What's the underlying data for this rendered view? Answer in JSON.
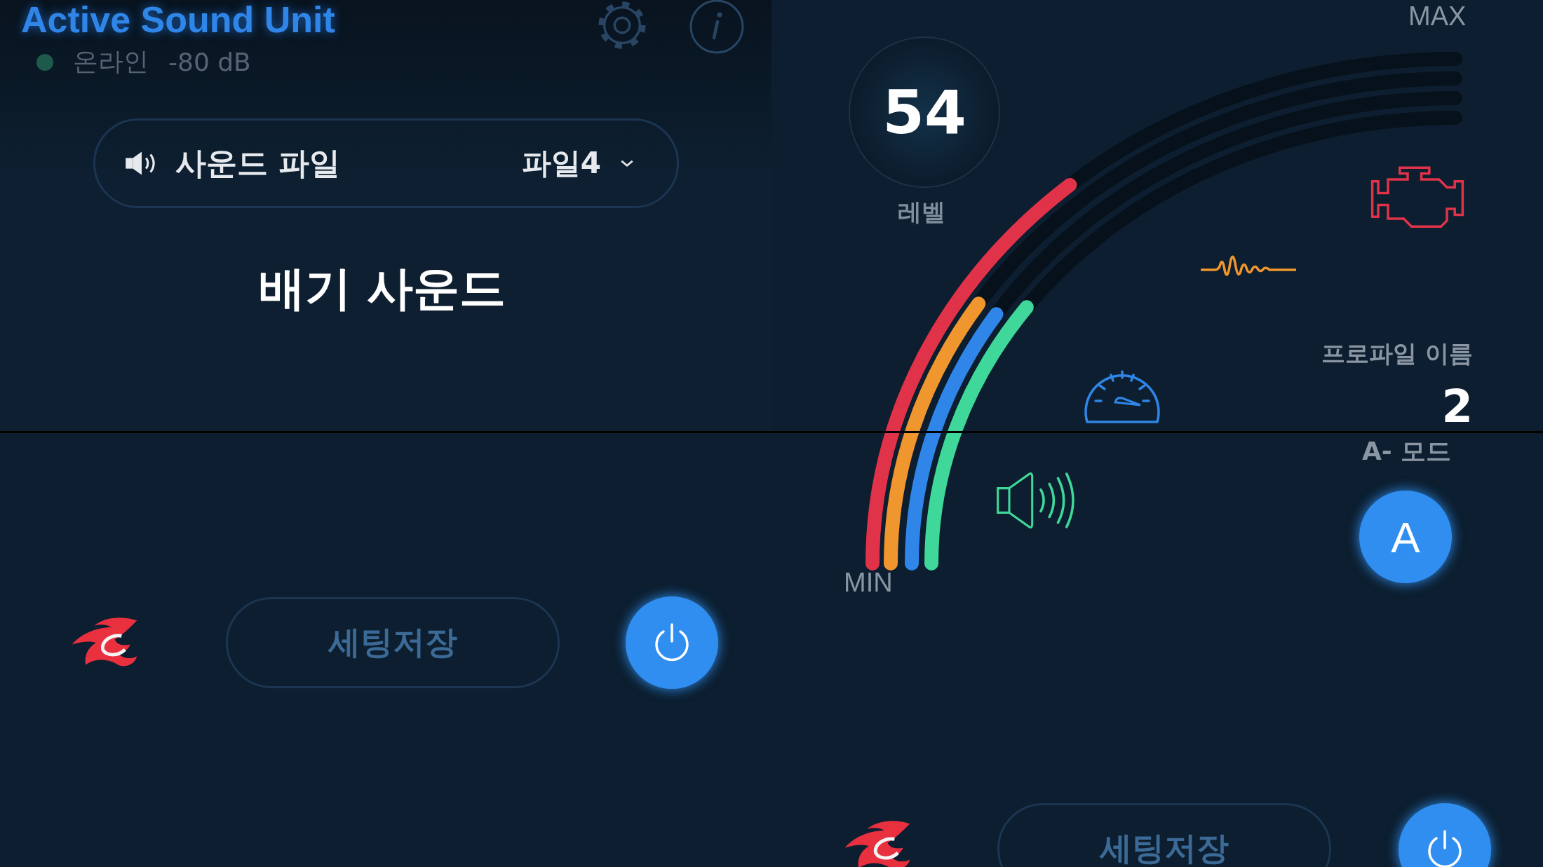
{
  "header": {
    "title": "Active Sound Unit",
    "status": "온라인",
    "reading": "-80 dB"
  },
  "sound_file": {
    "label": "사운드 파일",
    "value": "파일4"
  },
  "mode_title": "배기 사운드",
  "footer": {
    "save_button": "세팅저장"
  },
  "gauge": {
    "value": "54",
    "value_label": "레벨",
    "max_label": "MAX",
    "min_label": "MIN",
    "arcs": [
      {
        "color": "#e0334a"
      },
      {
        "color": "#f0962e"
      },
      {
        "color": "#2f86e8"
      },
      {
        "color": "#3fd79a"
      }
    ]
  },
  "profile": {
    "label": "프로파일 이름",
    "value": "2"
  },
  "mode": {
    "label": "A- 모드",
    "button": "A"
  },
  "footer_repeat": {
    "save_button": "세팅저장"
  }
}
